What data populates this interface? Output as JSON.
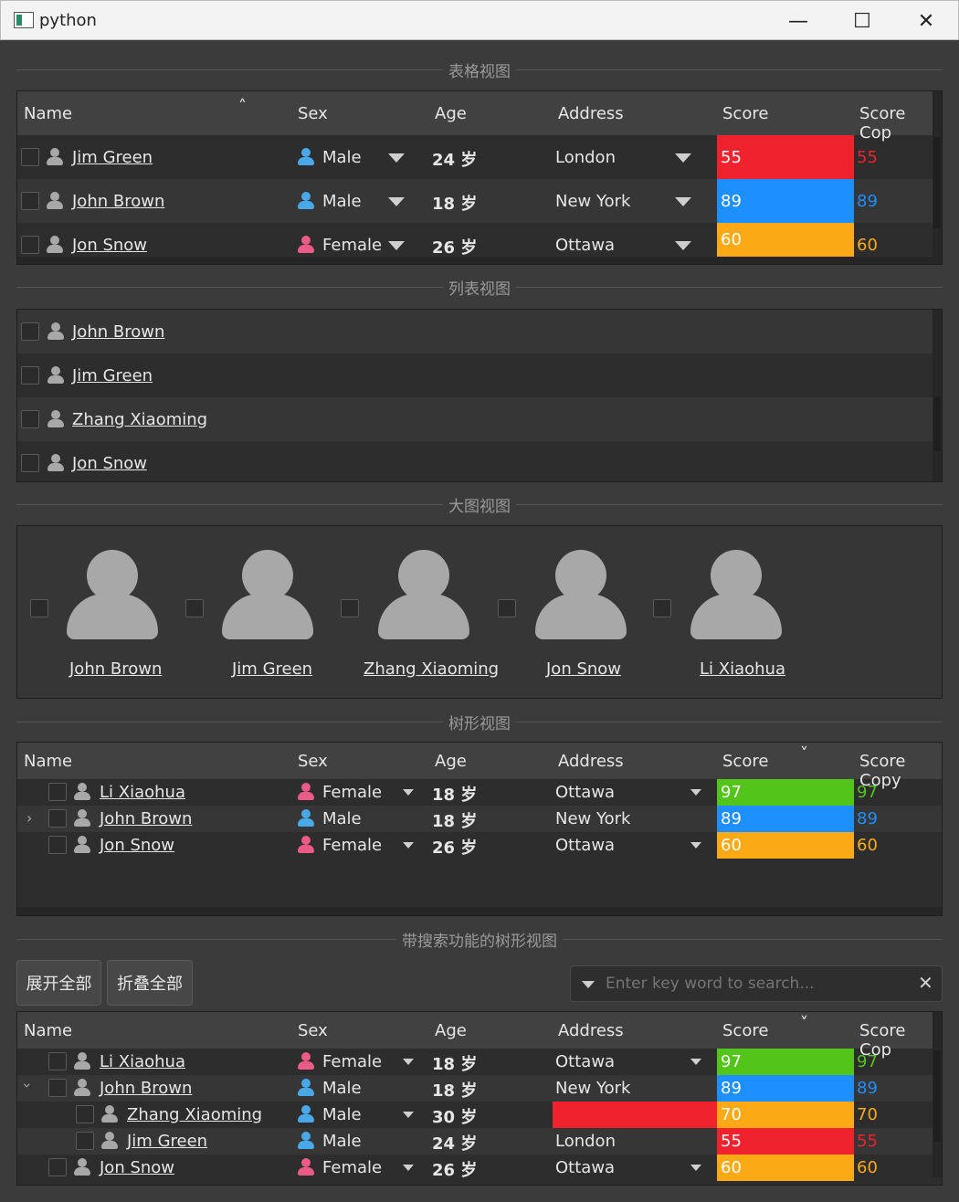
{
  "window": {
    "title": "python",
    "minimize": "—",
    "maximize": "☐",
    "close": "✕"
  },
  "sections": {
    "table": "表格视图",
    "list": "列表视图",
    "icon": "大图视图",
    "tree": "树形视图",
    "search_tree": "带搜索功能的树形视图"
  },
  "columns": [
    "Name",
    "Sex",
    "Age",
    "Address",
    "Score",
    "Score Cop"
  ],
  "tree_columns": [
    "Name",
    "Sex",
    "Age",
    "Address",
    "Score",
    "Score Copy"
  ],
  "colors": {
    "red": "#f0222e",
    "blue": "#1e8fff",
    "orange": "#fbaa16",
    "green": "#52c41a"
  },
  "table_rows": [
    {
      "name": "Jim Green",
      "sex": "Male",
      "age": "24 岁",
      "address": "London",
      "score": "55",
      "score_copy": "55"
    },
    {
      "name": "John Brown",
      "sex": "Male",
      "age": "18 岁",
      "address": "New York",
      "score": "89",
      "score_copy": "89"
    },
    {
      "name": "Jon Snow",
      "sex": "Female",
      "age": "26 岁",
      "address": "Ottawa",
      "score": "60",
      "score_copy": "60"
    }
  ],
  "list_items": [
    "John Brown",
    "Jim Green",
    "Zhang Xiaoming",
    "Jon Snow"
  ],
  "icon_items": [
    "John Brown",
    "Jim Green",
    "Zhang Xiaoming",
    "Jon Snow",
    "Li Xiaohua"
  ],
  "tree_rows": [
    {
      "name": "Li Xiaohua",
      "sex": "Female",
      "age": "18 岁",
      "address": "Ottawa",
      "score": "97",
      "score_copy": "97"
    },
    {
      "name": "John Brown",
      "sex": "Male",
      "age": "18 岁",
      "address": "New York",
      "score": "89",
      "score_copy": "89"
    },
    {
      "name": "Jon Snow",
      "sex": "Female",
      "age": "26 岁",
      "address": "Ottawa",
      "score": "60",
      "score_copy": "60"
    }
  ],
  "search_tree": {
    "expand_all": "展开全部",
    "collapse_all": "折叠全部",
    "search_placeholder": "Enter key word to search...",
    "rows": [
      {
        "name": "Li Xiaohua",
        "sex": "Female",
        "age": "18 岁",
        "address": "Ottawa",
        "score": "97",
        "score_copy": "97"
      },
      {
        "name": "John Brown",
        "sex": "Male",
        "age": "18 岁",
        "address": "New York",
        "score": "89",
        "score_copy": "89"
      },
      {
        "name": "Zhang Xiaoming",
        "sex": "Male",
        "age": "30 岁",
        "address": "",
        "score": "70",
        "score_copy": "70"
      },
      {
        "name": "Jim Green",
        "sex": "Male",
        "age": "24 岁",
        "address": "London",
        "score": "55",
        "score_copy": "55"
      },
      {
        "name": "Jon Snow",
        "sex": "Female",
        "age": "26 岁",
        "address": "Ottawa",
        "score": "60",
        "score_copy": "60"
      }
    ]
  }
}
